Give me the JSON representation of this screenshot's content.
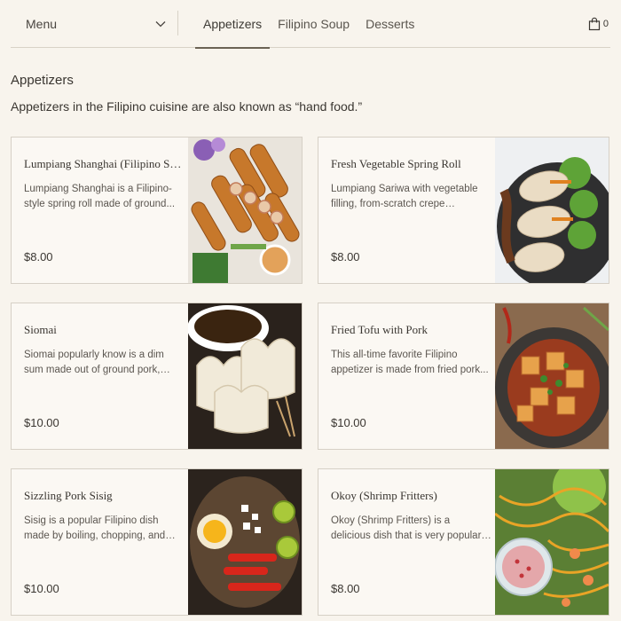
{
  "header": {
    "menu_label": "Menu",
    "tabs": [
      {
        "label": "Appetizers",
        "active": true
      },
      {
        "label": "Filipino Soup",
        "active": false
      },
      {
        "label": "Desserts",
        "active": false
      }
    ],
    "cart_count": "0",
    "cart_icon": "shopping-bag-icon"
  },
  "section": {
    "title": "Appetizers",
    "description": "Appetizers in the Filipino cuisine are also known as “hand food.”"
  },
  "items": [
    {
      "name": "Lumpiang Shanghai (Filipino Sprin...",
      "description": "Lumpiang Shanghai is a Filipino-style spring roll made of ground...",
      "price": "$8.00"
    },
    {
      "name": "Fresh Vegetable Spring Roll",
      "description": "Lumpiang Sariwa with vegetable filling, from-scratch crepe wrappers...",
      "price": "$8.00"
    },
    {
      "name": "Siomai",
      "description": "Siomai popularly know is a dim sum made out of ground pork, beef,...",
      "price": "$10.00"
    },
    {
      "name": "Fried Tofu with Pork",
      "description": "This all-time favorite Filipino appetizer is made from fried pork...",
      "price": "$10.00"
    },
    {
      "name": "Sizzling Pork Sisig",
      "description": "Sisig is a popular Filipino dish made by boiling, chopping, and grilling...",
      "price": "$10.00"
    },
    {
      "name": "Okoy (Shrimp Fritters)",
      "description": "Okoy (Shrimp Fritters) is a delicious dish that is very popular in the...",
      "price": "$8.00"
    }
  ],
  "colors": {
    "background": "#f8f4ed",
    "card_background": "#fbf8f3",
    "border": "#d6d0c6",
    "active_tab_underline": "#6b6355"
  }
}
